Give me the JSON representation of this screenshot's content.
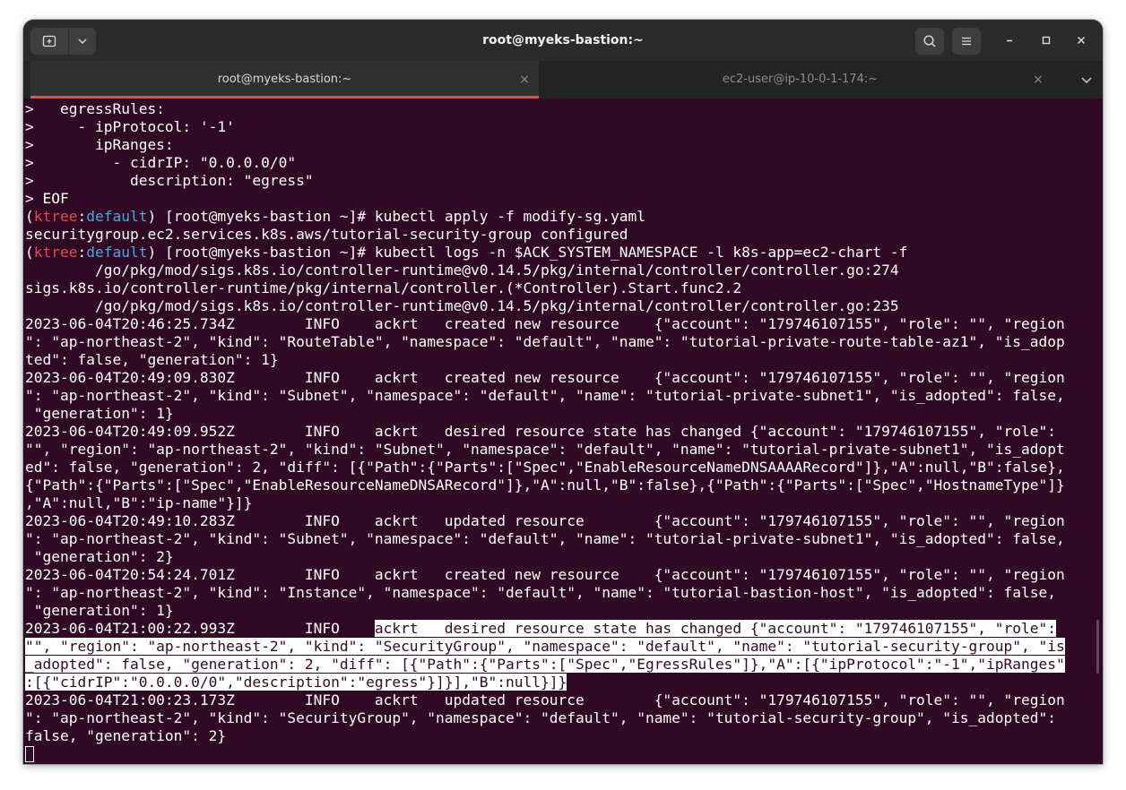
{
  "window": {
    "title": "root@myeks-bastion:~",
    "accent_color": "#e95420",
    "background_color": "#300a24"
  },
  "titlebar": {
    "new_tab_icon": "new-tab-icon",
    "menu_dropdown_icon": "chevron-down-icon",
    "search_icon": "search-icon",
    "hamburger_icon": "hamburger-menu-icon",
    "minimize_icon": "minimize-icon",
    "maximize_icon": "maximize-icon",
    "close_icon": "close-icon"
  },
  "tabs": [
    {
      "label": "root@myeks-bastion:~",
      "active": true,
      "close": "×"
    },
    {
      "label": "ec2-user@ip-10-0-1-174:~",
      "active": false,
      "close": "×"
    }
  ],
  "terminal": {
    "lines": [
      [
        {
          "t": ">   egressRules:"
        }
      ],
      [
        {
          "t": ">     - ipProtocol: '-1'"
        }
      ],
      [
        {
          "t": ">       ipRanges:"
        }
      ],
      [
        {
          "t": ">         - cidrIP: \"0.0.0.0/0\""
        }
      ],
      [
        {
          "t": ">           description: \"egress\""
        }
      ],
      [
        {
          "t": "> EOF"
        }
      ],
      [
        {
          "t": "("
        },
        {
          "t": "ktree",
          "c": "red"
        },
        {
          "t": ":"
        },
        {
          "t": "default",
          "c": "blue"
        },
        {
          "t": ") [root@myeks-bastion ~]# kubectl apply -f modify-sg.yaml"
        }
      ],
      [
        {
          "t": "securitygroup.ec2.services.k8s.aws/tutorial-security-group configured"
        }
      ],
      [
        {
          "t": "("
        },
        {
          "t": "ktree",
          "c": "red"
        },
        {
          "t": ":"
        },
        {
          "t": "default",
          "c": "blue"
        },
        {
          "t": ") [root@myeks-bastion ~]# kubectl logs -n $ACK_SYSTEM_NAMESPACE -l k8s-app=ec2-chart -f"
        }
      ],
      [
        {
          "t": "        /go/pkg/mod/sigs.k8s.io/controller-runtime@v0.14.5/pkg/internal/controller/controller.go:274"
        }
      ],
      [
        {
          "t": "sigs.k8s.io/controller-runtime/pkg/internal/controller.(*Controller).Start.func2.2"
        }
      ],
      [
        {
          "t": "        /go/pkg/mod/sigs.k8s.io/controller-runtime@v0.14.5/pkg/internal/controller/controller.go:235"
        }
      ],
      [
        {
          "t": "2023-06-04T20:46:25.734Z        INFO    ackrt   created new resource    {\"account\": \"179746107155\", \"role\": \"\", \"region"
        }
      ],
      [
        {
          "t": "\": \"ap-northeast-2\", \"kind\": \"RouteTable\", \"namespace\": \"default\", \"name\": \"tutorial-private-route-table-az1\", \"is_adop"
        }
      ],
      [
        {
          "t": "ted\": false, \"generation\": 1}"
        }
      ],
      [
        {
          "t": "2023-06-04T20:49:09.830Z        INFO    ackrt   created new resource    {\"account\": \"179746107155\", \"role\": \"\", \"region"
        }
      ],
      [
        {
          "t": "\": \"ap-northeast-2\", \"kind\": \"Subnet\", \"namespace\": \"default\", \"name\": \"tutorial-private-subnet1\", \"is_adopted\": false,"
        }
      ],
      [
        {
          "t": " \"generation\": 1}"
        }
      ],
      [
        {
          "t": "2023-06-04T20:49:09.952Z        INFO    ackrt   desired resource state has changed {\"account\": \"179746107155\", \"role\":"
        }
      ],
      [
        {
          "t": "\"\", \"region\": \"ap-northeast-2\", \"kind\": \"Subnet\", \"namespace\": \"default\", \"name\": \"tutorial-private-subnet1\", \"is_adopt"
        }
      ],
      [
        {
          "t": "ed\": false, \"generation\": 2, \"diff\": [{\"Path\":{\"Parts\":[\"Spec\",\"EnableResourceNameDNSAAAARecord\"]},\"A\":null,\"B\":false},"
        }
      ],
      [
        {
          "t": "{\"Path\":{\"Parts\":[\"Spec\",\"EnableResourceNameDNSARecord\"]},\"A\":null,\"B\":false},{\"Path\":{\"Parts\":[\"Spec\",\"HostnameType\"]}"
        }
      ],
      [
        {
          "t": ",\"A\":null,\"B\":\"ip-name\"}]}"
        }
      ],
      [
        {
          "t": "2023-06-04T20:49:10.283Z        INFO    ackrt   updated resource        {\"account\": \"179746107155\", \"role\": \"\", \"region"
        }
      ],
      [
        {
          "t": "\": \"ap-northeast-2\", \"kind\": \"Subnet\", \"namespace\": \"default\", \"name\": \"tutorial-private-subnet1\", \"is_adopted\": false,"
        }
      ],
      [
        {
          "t": " \"generation\": 2}"
        }
      ],
      [
        {
          "t": "2023-06-04T20:54:24.701Z        INFO    ackrt   created new resource    {\"account\": \"179746107155\", \"role\": \"\", \"region"
        }
      ],
      [
        {
          "t": "\": \"ap-northeast-2\", \"kind\": \"Instance\", \"namespace\": \"default\", \"name\": \"tutorial-bastion-host\", \"is_adopted\": false,"
        }
      ],
      [
        {
          "t": " \"generation\": 1}"
        }
      ],
      [
        {
          "t": "2023-06-04T21:00:22.993Z        INFO    "
        },
        {
          "t": "ackrt   desired resource state has changed {\"account\": \"179746107155\", \"role\":",
          "c": "hl"
        }
      ],
      [
        {
          "t": "\"\", \"region\": \"ap-northeast-2\", \"kind\": \"SecurityGroup\", \"namespace\": \"default\", \"name\": \"tutorial-security-group\", \"is",
          "c": "hl"
        }
      ],
      [
        {
          "t": "_adopted\": false, \"generation\": 2, \"diff\": [{\"Path\":{\"Parts\":[\"Spec\",\"EgressRules\"]},\"A\":[{\"ipProtocol\":\"-1\",\"ipRanges\"",
          "c": "hl"
        }
      ],
      [
        {
          "t": ":[{\"cidrIP\":\"0.0.0.0/0\",\"description\":\"egress\"}]}],\"B\":null}]}",
          "c": "hl"
        }
      ],
      [
        {
          "t": "2023-06-04T21:00:23.173Z        INFO    ackrt   updated resource        {\"account\": \"179746107155\", \"role\": \"\", \"region"
        }
      ],
      [
        {
          "t": "\": \"ap-northeast-2\", \"kind\": \"SecurityGroup\", \"namespace\": \"default\", \"name\": \"tutorial-security-group\", \"is_adopted\":"
        }
      ],
      [
        {
          "t": "false, \"generation\": 2}"
        }
      ]
    ]
  }
}
